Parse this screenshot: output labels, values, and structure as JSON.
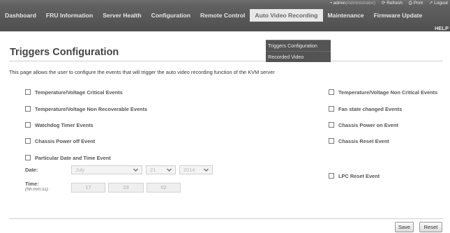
{
  "topbar": {
    "user": "admin",
    "role": "(Administrator)",
    "refresh": "Refresh",
    "print": "Print",
    "logout": "Logout"
  },
  "nav": {
    "items": [
      {
        "label": "Dashboard"
      },
      {
        "label": "FRU Information"
      },
      {
        "label": "Server Health"
      },
      {
        "label": "Configuration"
      },
      {
        "label": "Remote Control"
      },
      {
        "label": "Auto Video Recording"
      },
      {
        "label": "Maintenance"
      },
      {
        "label": "Firmware Update"
      }
    ],
    "help": "HELP"
  },
  "dropdown": {
    "items": [
      {
        "label": "Triggers Configuration"
      },
      {
        "label": "Recorded Video"
      }
    ]
  },
  "page": {
    "title": "Triggers Configuration",
    "description": "This page allows the user to configure the events that will trigger the auto video recording function of the KVM server"
  },
  "events": {
    "left": [
      {
        "label": "Temperature/Voltage Critical Events",
        "checked": false
      },
      {
        "label": "Temperature/Voltage Non Recoverable Events",
        "checked": false
      },
      {
        "label": "Watchdog Timer Events",
        "checked": false
      },
      {
        "label": "Chassis Power off Event",
        "checked": false
      },
      {
        "label": "Particular Date and Time Event",
        "checked": false
      }
    ],
    "right": [
      {
        "label": "Temperature/Voltage Non Critical Events",
        "checked": false
      },
      {
        "label": "Fan state changed Events",
        "checked": false
      },
      {
        "label": "Chassis Power on Event",
        "checked": false
      },
      {
        "label": "Chassis Reset Event",
        "checked": false
      },
      {
        "label": "LPC Reset Event",
        "checked": false
      }
    ]
  },
  "schedule": {
    "date_label": "Date:",
    "month": "July",
    "day": "21",
    "year": "2014",
    "time_label": "Time:",
    "time_format": "(hh:mm:ss)",
    "hh": "17",
    "mm": "23",
    "ss": "02"
  },
  "actions": {
    "save": "Save",
    "reset": "Reset"
  },
  "colors": {
    "navbar": "#555555",
    "active_tab": "#e8e8e8",
    "dropdown": "#545454"
  }
}
